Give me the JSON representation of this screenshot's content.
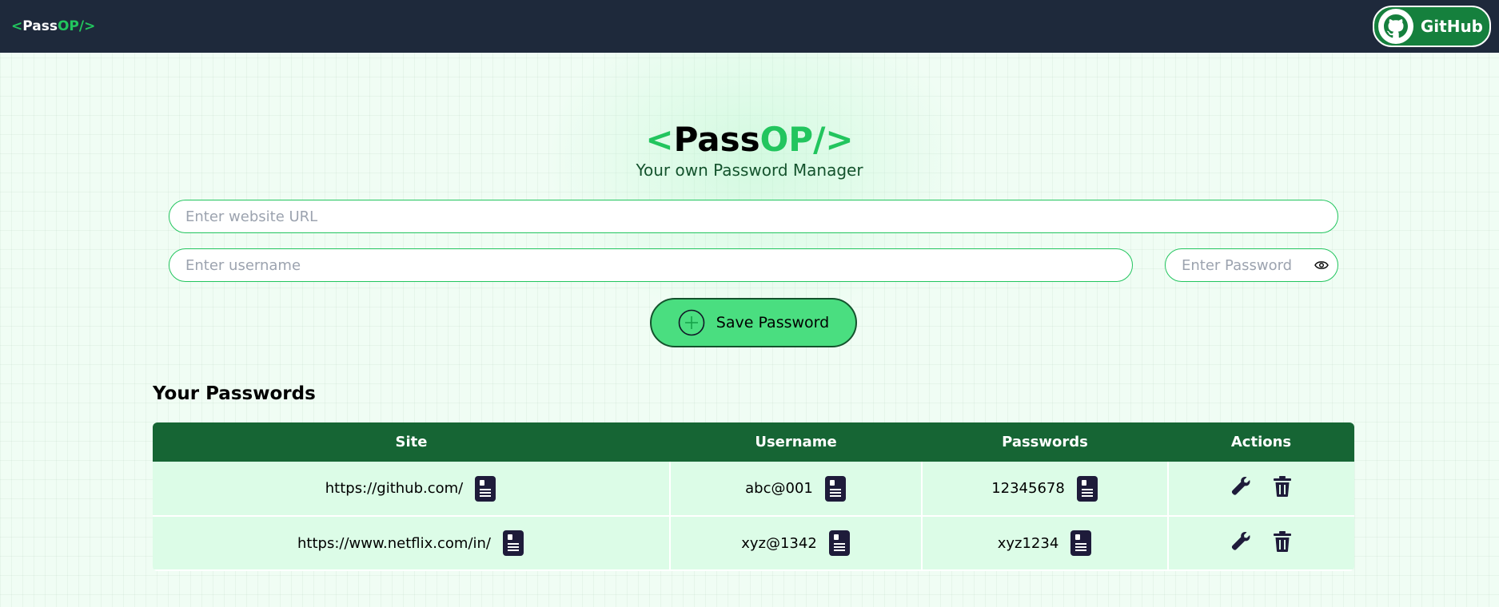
{
  "navbar": {
    "brand": {
      "open": "<",
      "pass": "Pass",
      "op": "OP/>"
    },
    "github_label": "GitHub"
  },
  "header": {
    "title": {
      "open": "<",
      "pass": "Pass",
      "op": "OP/>"
    },
    "subtitle": "Your own Password Manager"
  },
  "form": {
    "url_placeholder": "Enter website URL",
    "username_placeholder": "Enter username",
    "password_placeholder": "Enter Password",
    "save_label": "Save Password"
  },
  "passwords": {
    "heading": "Your Passwords",
    "columns": [
      "Site",
      "Username",
      "Passwords",
      "Actions"
    ],
    "rows": [
      {
        "site": "https://github.com/",
        "username": "abc@001",
        "password": "12345678"
      },
      {
        "site": "https://www.netflix.com/in/",
        "username": "xyz@1342",
        "password": "xyz1234"
      }
    ]
  },
  "colors": {
    "accent": "#22c55e",
    "navbar": "#1e293b",
    "table_header": "#166534",
    "row_bg": "#dcfce7",
    "save_button": "#4ade80"
  },
  "icons": {
    "github": "github-icon",
    "eye": "eye-icon",
    "add": "add-circle-icon",
    "copy": "copy-icon",
    "edit": "edit-icon",
    "delete": "delete-icon"
  }
}
